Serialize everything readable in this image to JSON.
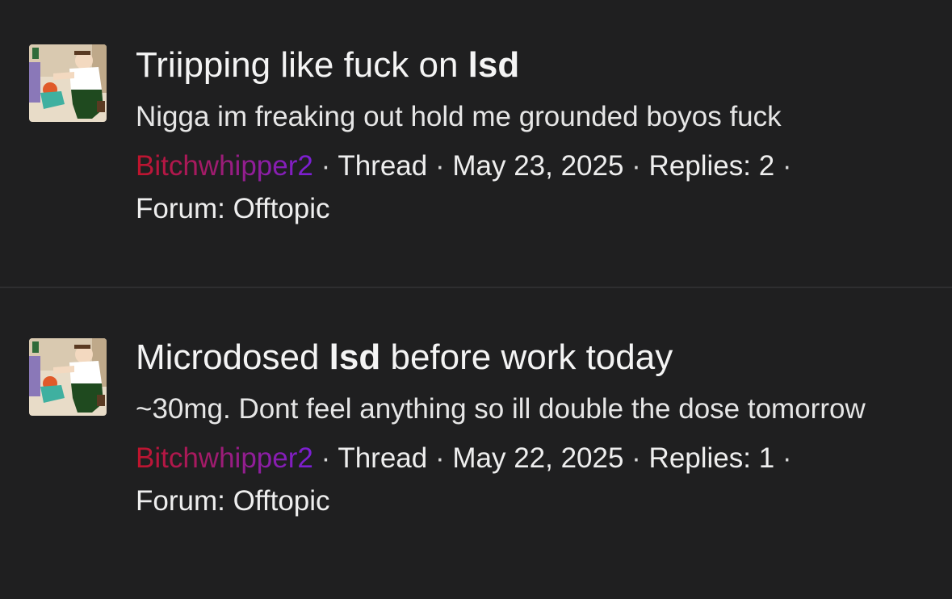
{
  "results": [
    {
      "title_before": "Triipping like fuck on ",
      "title_bold": "lsd",
      "title_after": "",
      "snippet": "Nigga im freaking out hold me grounded boyos fuck",
      "author": "Bitchwhipper2",
      "type": "Thread",
      "date": "May 23, 2025",
      "replies": "Replies: 2",
      "forum": "Forum: Offtopic"
    },
    {
      "title_before": "Microdosed ",
      "title_bold": "lsd",
      "title_after": " before work today",
      "snippet": "~30mg. Dont feel anything so ill double the dose tomorrow",
      "author": "Bitchwhipper2",
      "type": "Thread",
      "date": "May 22, 2025",
      "replies": "Replies: 1",
      "forum": "Forum: Offtopic"
    }
  ],
  "separator": " · ",
  "colors": {
    "background": "#1f1f20",
    "author_gradient_start": "#c0142a",
    "author_gradient_end": "#7a1fd8"
  }
}
